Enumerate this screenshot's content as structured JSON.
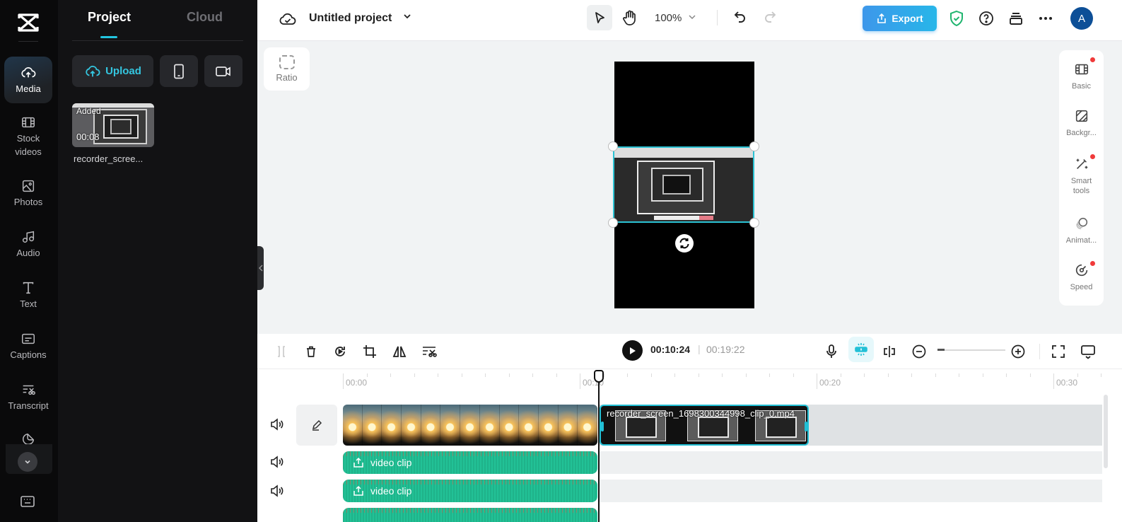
{
  "rail": {
    "items": [
      {
        "id": "media",
        "label": "Media",
        "icon": "cloud-upload-icon",
        "active": true
      },
      {
        "id": "stock-videos",
        "label": "Stock videos",
        "icon": "film-icon"
      },
      {
        "id": "photos",
        "label": "Photos",
        "icon": "image-icon"
      },
      {
        "id": "audio",
        "label": "Audio",
        "icon": "music-note-icon"
      },
      {
        "id": "text",
        "label": "Text",
        "icon": "text-icon"
      },
      {
        "id": "captions",
        "label": "Captions",
        "icon": "captions-icon"
      },
      {
        "id": "transcript",
        "label": "Transcript",
        "icon": "transcript-icon"
      },
      {
        "id": "stickers",
        "label": "",
        "icon": "sticker-icon"
      }
    ]
  },
  "panel": {
    "tabs": [
      {
        "label": "Project",
        "active": true
      },
      {
        "label": "Cloud"
      }
    ],
    "upload_label": "Upload",
    "media_items": [
      {
        "badge": "Added",
        "duration": "00:08",
        "name": "recorder_scree..."
      }
    ]
  },
  "topbar": {
    "project_title": "Untitled project",
    "zoom": "100%",
    "export_label": "Export",
    "avatar_initial": "A"
  },
  "canvas": {
    "ratio_label": "Ratio"
  },
  "properties": {
    "items": [
      {
        "label": "Basic",
        "icon": "film-icon",
        "dot": true
      },
      {
        "label": "Backgr...",
        "icon": "background-icon",
        "dot": false
      },
      {
        "label": "Smart tools",
        "icon": "magic-wand-icon",
        "dot": true
      },
      {
        "label": "Animat...",
        "icon": "animation-icon",
        "dot": false
      },
      {
        "label": "Speed",
        "icon": "speedometer-icon",
        "dot": true
      }
    ]
  },
  "timeline": {
    "current_time": "00:10:24",
    "separator": "|",
    "total_time": "00:19:22",
    "ruler_labels": [
      "00:00",
      "00:10",
      "00:20",
      "00:30"
    ],
    "zoom_level": 0.1,
    "clips": {
      "main_video_name": "recorder_screen_1698300344998_clip_0.mp4",
      "audio_clips": [
        {
          "label": "video clip"
        },
        {
          "label": "video clip"
        }
      ]
    }
  },
  "colors": {
    "accent": "#22c5e0",
    "export_gradient_start": "#3d97ea",
    "export_gradient_end": "#27b6e9",
    "audio_clip": "#1fb38a",
    "notification_dot": "#f03a3a",
    "avatar": "#0d4f97"
  }
}
